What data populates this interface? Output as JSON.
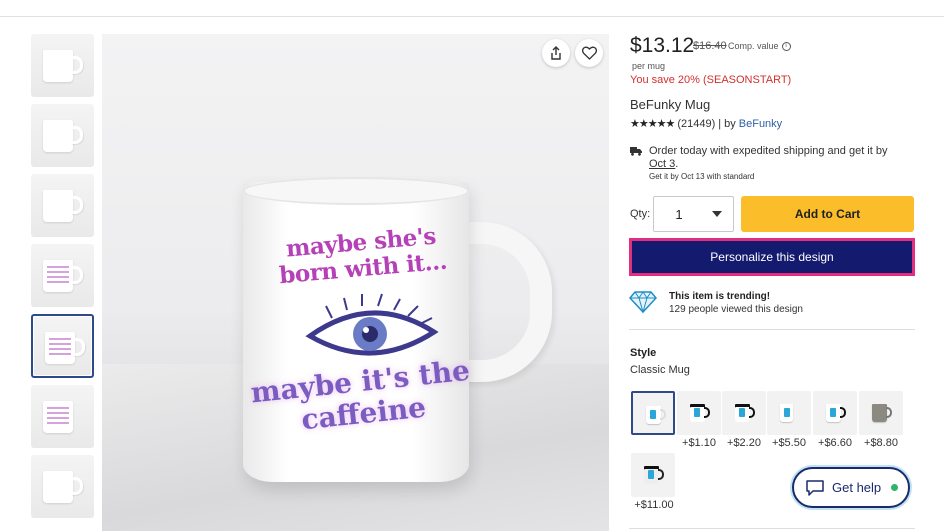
{
  "product": {
    "price": "$13.12",
    "original_price": "$16.40",
    "comp_value_label": "Comp. value",
    "unit_label": "per mug",
    "savings_text": "You save 20% (SEASONSTART)",
    "name": "BeFunky Mug",
    "stars": "★★★★★",
    "review_count": "(21449)",
    "by_label": "| by",
    "brand": "BeFunky"
  },
  "shipping": {
    "line1": "Order today with expedited shipping and get it by",
    "date": "Oct 3",
    "date_suffix": ".",
    "line2": "Get it by Oct 13 with standard"
  },
  "purchase": {
    "qty_label": "Qty:",
    "qty_value": "1",
    "add_to_cart": "Add to Cart",
    "personalize": "Personalize this design"
  },
  "trending": {
    "title": "This item is trending!",
    "subtitle": "129 people viewed this design"
  },
  "style": {
    "label": "Style",
    "value": "Classic Mug",
    "option_prices": [
      "",
      "+$1.10",
      "+$2.20",
      "+$5.50",
      "+$6.60",
      "+$8.80",
      "+$11.00"
    ]
  },
  "mug_print": {
    "line1": "maybe she's born with it...",
    "line2": "maybe it's the caffeine"
  },
  "help": {
    "label": "Get help"
  },
  "colors": {
    "add_to_cart_bg": "#fbbd2a",
    "personalize_bg": "#141a6e",
    "personalize_border": "#e22e7e",
    "savings_text": "#d32f2f",
    "brand_link": "#2e5fa8",
    "online_dot": "#2fb56a"
  },
  "icons": [
    "share-icon",
    "heart-icon",
    "info-icon",
    "truck-icon",
    "chevron-down-icon",
    "diamond-icon",
    "chat-bubble-icon"
  ]
}
